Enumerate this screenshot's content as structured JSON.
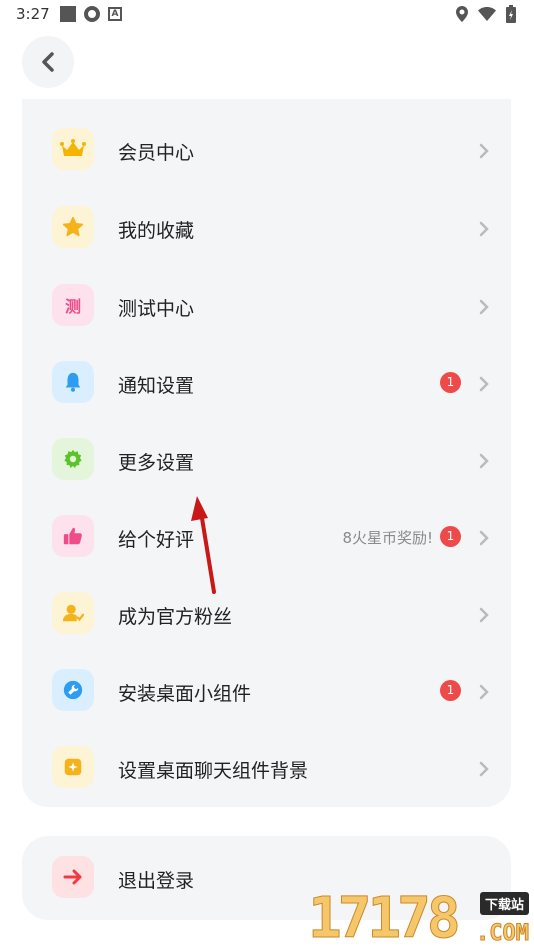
{
  "status_bar": {
    "time": "3:27"
  },
  "back_button": {
    "icon": "chevron-left-icon"
  },
  "menu": [
    {
      "label": "会员中心",
      "icon": "crown-icon",
      "icon_bg": "#fdf3d5",
      "icon_color": "#f4b400",
      "badge": "",
      "hint": ""
    },
    {
      "label": "我的收藏",
      "icon": "star-icon",
      "icon_bg": "#fdf3d5",
      "icon_color": "#f5b31b",
      "badge": "",
      "hint": ""
    },
    {
      "label": "测试中心",
      "icon": "test-icon",
      "icon_bg": "#fde1ec",
      "icon_color": "#ef4d8a",
      "icon_text": "测",
      "badge": "",
      "hint": ""
    },
    {
      "label": "通知设置",
      "icon": "bell-icon",
      "icon_bg": "#d9efff",
      "icon_color": "#2e9cf0",
      "badge": "1",
      "hint": ""
    },
    {
      "label": "更多设置",
      "icon": "gear-icon",
      "icon_bg": "#e5f5dc",
      "icon_color": "#5bc428",
      "badge": "",
      "hint": ""
    },
    {
      "label": "给个好评",
      "icon": "thumbs-up-icon",
      "icon_bg": "#fde1ec",
      "icon_color": "#ef4d8a",
      "badge": "1",
      "hint": "8火星币奖励!"
    },
    {
      "label": "成为官方粉丝",
      "icon": "fan-user-icon",
      "icon_bg": "#fdf3d5",
      "icon_color": "#f5b31b",
      "badge": "",
      "hint": ""
    },
    {
      "label": "安装桌面小组件",
      "icon": "widget-icon",
      "icon_bg": "#d9efff",
      "icon_color": "#2e9cf0",
      "badge": "1",
      "hint": ""
    },
    {
      "label": "设置桌面聊天组件背景",
      "icon": "background-icon",
      "icon_bg": "#fdf3d5",
      "icon_color": "#f5b31b",
      "badge": "",
      "hint": ""
    }
  ],
  "logout": {
    "label": "退出登录",
    "icon": "arrow-right-icon",
    "icon_bg": "#fde1e3",
    "icon_color": "#ee3b44"
  },
  "watermark": {
    "number": "17178",
    "tag": "下载站",
    "domain": ".COM"
  },
  "colors": {
    "badge": "#ee4a4a",
    "card_bg": "#f4f5f7",
    "annotation_arrow": "#d01818"
  }
}
